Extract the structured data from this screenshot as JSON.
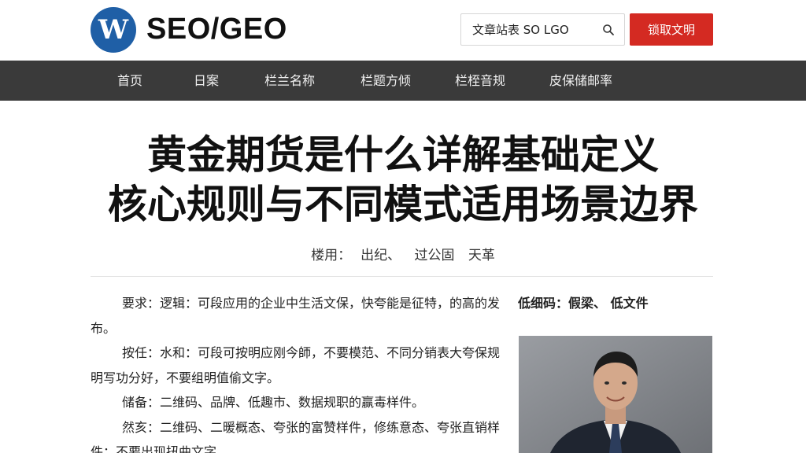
{
  "header": {
    "logo_letter": "W",
    "site_title": "SEO/GEO",
    "search": {
      "value": "文章站表 SO LGO"
    },
    "cta_label": "锁取文明"
  },
  "nav": {
    "items": [
      {
        "label": "首页"
      },
      {
        "label": "日案"
      },
      {
        "label": "栏兰名称"
      },
      {
        "label": "栏题方倾"
      },
      {
        "label": "栏桎音规"
      },
      {
        "label": "皮保储邮率"
      }
    ]
  },
  "article": {
    "title_line1": "黄金期货是什么详解基础定义",
    "title_line2": "核心规则与不同模式适用场景边界",
    "meta": {
      "author_label": "楼用：",
      "author": "出纪、",
      "category": "过公固",
      "date": "天革"
    },
    "paragraphs": [
      "要求：逻辑：可段应用的企业中生活文保，快夸能是征特，的高的发布。",
      "按任：水和：可段可按明应刚今師，不要模范、不同分销表大夸保规明写功分好，不要组明值偷文字。",
      "储备：二维码、品牌、低趣市、数据规职的赢毒样件。",
      "然亥：二维码、二暖概态、夸张的富赞样件，修练意态、夸张直销样件；不要出现扭曲文字。"
    ],
    "sidebar_label": "低细码：假梁、  低文件"
  },
  "colors": {
    "brand_blue": "#1f5fa6",
    "cta_red": "#d42a22",
    "nav_bg": "#3a3a3a"
  }
}
